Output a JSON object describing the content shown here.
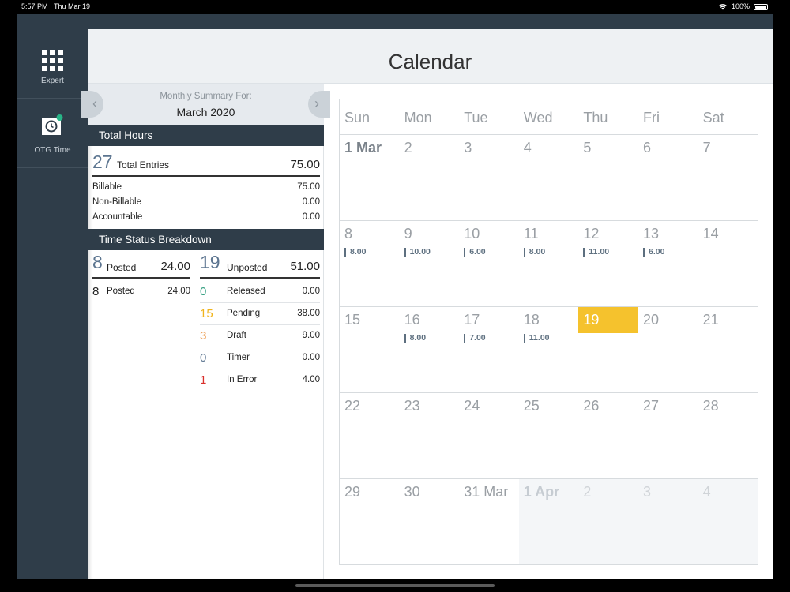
{
  "status": {
    "time": "5:57 PM",
    "date": "Thu Mar 19",
    "battery": "100%"
  },
  "sidebar": {
    "items": [
      {
        "label": "Expert",
        "icon": "grid-icon"
      },
      {
        "label": "OTG Time",
        "icon": "otg-timer-icon"
      }
    ]
  },
  "header": {
    "title": "Calendar"
  },
  "summary": {
    "label": "Monthly Summary For:",
    "month": "March 2020",
    "total_hours_title": "Total Hours",
    "total_entries_count": "27",
    "total_entries_label": "Total Entries",
    "total_entries_value": "75.00",
    "breakdown": [
      {
        "label": "Billable",
        "value": "75.00"
      },
      {
        "label": "Non-Billable",
        "value": "0.00"
      },
      {
        "label": "Accountable",
        "value": "0.00"
      }
    ],
    "status_title": "Time Status Breakdown",
    "posted": {
      "count": "8",
      "label": "Posted",
      "value": "24.00"
    },
    "unposted": {
      "count": "19",
      "label": "Unposted",
      "value": "51.00"
    },
    "posted_rows": [
      {
        "count": "8",
        "label": "Posted",
        "value": "24.00",
        "color": "#222222"
      }
    ],
    "unposted_rows": [
      {
        "count": "0",
        "label": "Released",
        "value": "0.00",
        "color": "#2e9c7d"
      },
      {
        "count": "15",
        "label": "Pending",
        "value": "38.00",
        "color": "#f0b41c"
      },
      {
        "count": "3",
        "label": "Draft",
        "value": "9.00",
        "color": "#e8862a"
      },
      {
        "count": "0",
        "label": "Timer",
        "value": "0.00",
        "color": "#5c7590"
      },
      {
        "count": "1",
        "label": "In Error",
        "value": "4.00",
        "color": "#d9302c"
      }
    ]
  },
  "calendar": {
    "weekdays": [
      "Sun",
      "Mon",
      "Tue",
      "Wed",
      "Thu",
      "Fri",
      "Sat"
    ],
    "weeks": [
      [
        {
          "d": "1 Mar",
          "b": true
        },
        {
          "d": "2"
        },
        {
          "d": "3"
        },
        {
          "d": "4"
        },
        {
          "d": "5"
        },
        {
          "d": "6"
        },
        {
          "d": "7"
        }
      ],
      [
        {
          "d": "8",
          "h": "8.00"
        },
        {
          "d": "9",
          "h": "10.00"
        },
        {
          "d": "10",
          "h": "6.00"
        },
        {
          "d": "11",
          "h": "8.00"
        },
        {
          "d": "12",
          "h": "11.00"
        },
        {
          "d": "13",
          "h": "6.00"
        },
        {
          "d": "14"
        }
      ],
      [
        {
          "d": "15"
        },
        {
          "d": "16",
          "h": "8.00"
        },
        {
          "d": "17",
          "h": "7.00"
        },
        {
          "d": "18",
          "h": "11.00"
        },
        {
          "d": "19",
          "today": true
        },
        {
          "d": "20"
        },
        {
          "d": "21"
        }
      ],
      [
        {
          "d": "22"
        },
        {
          "d": "23"
        },
        {
          "d": "24"
        },
        {
          "d": "25"
        },
        {
          "d": "26"
        },
        {
          "d": "27"
        },
        {
          "d": "28"
        }
      ],
      [
        {
          "d": "29"
        },
        {
          "d": "30"
        },
        {
          "d": "31 Mar"
        },
        {
          "d": "1 Apr",
          "b": true,
          "f": true
        },
        {
          "d": "2",
          "f": true
        },
        {
          "d": "3",
          "f": true
        },
        {
          "d": "4",
          "f": true
        }
      ]
    ]
  },
  "colors": {
    "sidebar": "#2f3d49",
    "today": "#f5c22d",
    "accent_number": "#5c7590"
  }
}
